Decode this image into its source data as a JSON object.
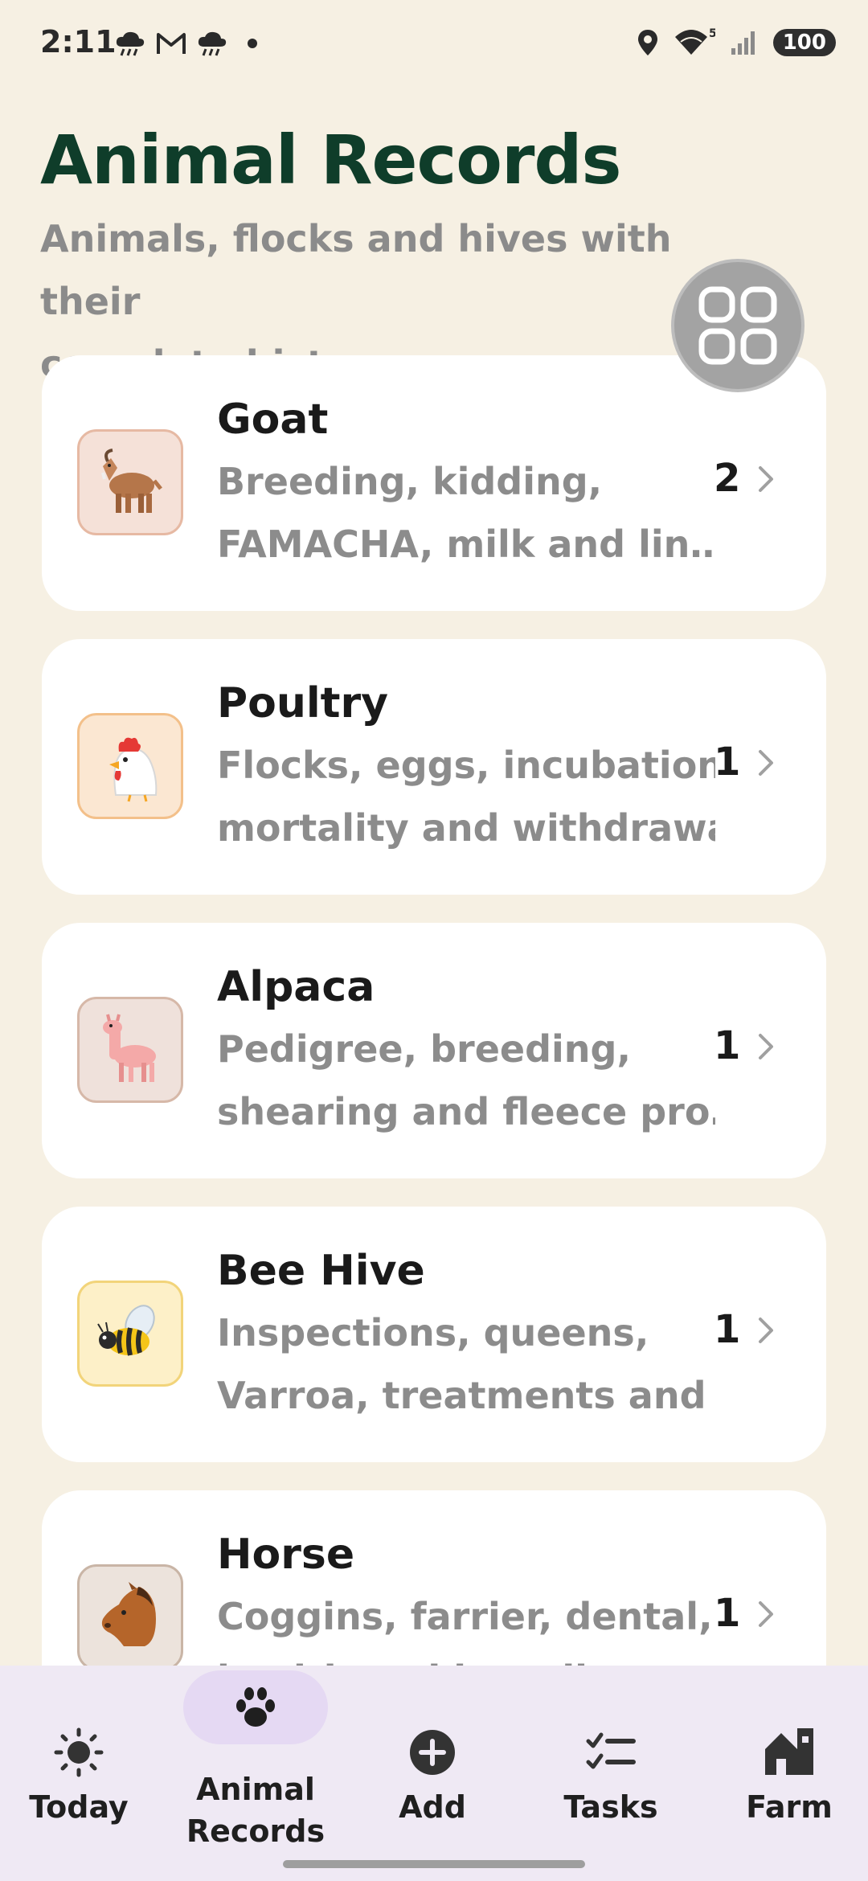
{
  "status_bar": {
    "time": "2:11",
    "battery": "100",
    "left_icons": [
      "storm-cloud-icon",
      "gmail-icon",
      "storm-cloud-icon",
      "dot-icon"
    ],
    "right_icons": [
      "location-icon",
      "wifi-icon",
      "signal-icon"
    ],
    "wifi_badge": "5"
  },
  "header": {
    "title": "Animal Records",
    "subtitle_line1": "Animals, flocks and hives with their",
    "subtitle_line2": "complete history."
  },
  "fab": {
    "icon": "grid-icon"
  },
  "cards": [
    {
      "title": "Goat",
      "desc_line1": "Breeding, kidding,",
      "desc_line2": "FAMACHA, milk and lin…",
      "count": "2",
      "icon": "goat-icon",
      "icon_bg": "#f5e1d8",
      "icon_border": "#e6b9a3"
    },
    {
      "title": "Poultry",
      "desc_line1": "Flocks, eggs, incubation,",
      "desc_line2": "mortality and withdrawa…",
      "count": "1",
      "icon": "chicken-icon",
      "icon_bg": "#fbe7d2",
      "icon_border": "#f3c08a"
    },
    {
      "title": "Alpaca",
      "desc_line1": "Pedigree, breeding,",
      "desc_line2": "shearing and fleece pro…",
      "count": "1",
      "icon": "llama-icon",
      "icon_bg": "#efe1db",
      "icon_border": "#d6b8a8"
    },
    {
      "title": "Bee Hive",
      "desc_line1": "Inspections, queens,",
      "desc_line2": "Varroa, treatments and …",
      "count": "1",
      "icon": "bee-icon",
      "icon_bg": "#fdf0c8",
      "icon_border": "#f2d47a"
    },
    {
      "title": "Horse",
      "desc_line1": "Coggins, farrier, dental,",
      "desc_line2": "health and breeding",
      "count": "1",
      "icon": "horse-icon",
      "icon_bg": "#ece3dc",
      "icon_border": "#c9b5a6"
    }
  ],
  "bottom_nav": {
    "items": [
      {
        "label": "Today",
        "icon": "sun-icon"
      },
      {
        "label_line1": "Animal",
        "label_line2": "Records",
        "icon": "paw-icon",
        "selected": true
      },
      {
        "label": "Add",
        "icon": "add-circle-icon"
      },
      {
        "label": "Tasks",
        "icon": "checklist-icon"
      },
      {
        "label": "Farm",
        "icon": "farm-icon"
      }
    ]
  },
  "colors": {
    "background": "#f6f0e3",
    "title": "#0f3d2a",
    "nav_background": "#efe9f4",
    "nav_selected_pill": "#e5d9f3"
  }
}
